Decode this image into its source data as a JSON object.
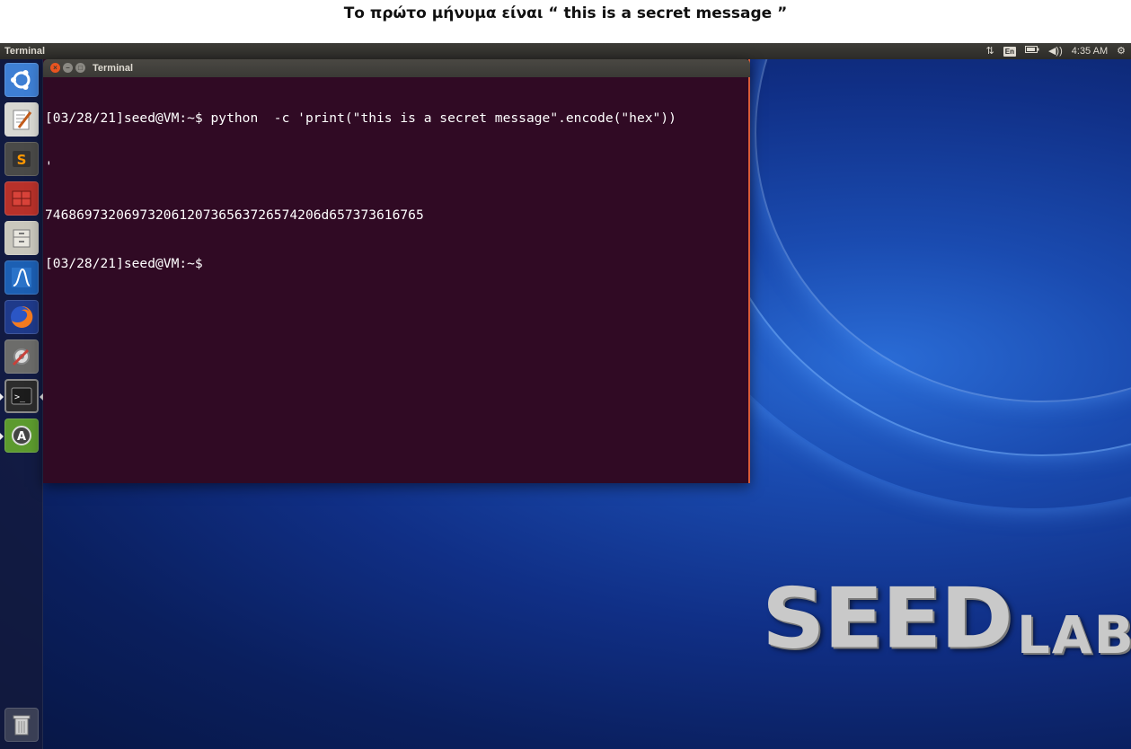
{
  "caption": "Το πρώτο μήνυμα είναι “ this is a secret message ”",
  "top_panel": {
    "app_title": "Terminal",
    "network_icon": "network-arrows-icon",
    "keyboard_layout": "En",
    "battery_icon": "battery-icon",
    "volume_icon": "volume-icon",
    "clock": "4:35 AM",
    "settings_icon": "gear-icon"
  },
  "launcher": {
    "items": [
      {
        "name": "ubuntu-dash",
        "icon": "ubuntu-logo-icon",
        "color": "#3e7fd4"
      },
      {
        "name": "text-editor",
        "icon": "text-editor-icon",
        "color": "#d8d8d2"
      },
      {
        "name": "sublime-text",
        "icon": "sublime-text-icon",
        "color": "#4a4a48"
      },
      {
        "name": "wireshark-red",
        "icon": "red-app-icon",
        "color": "#b8312a"
      },
      {
        "name": "file-manager",
        "icon": "file-cabinet-icon",
        "color": "#c9c7bd"
      },
      {
        "name": "wireshark",
        "icon": "wireshark-icon",
        "color": "#1c5fb3"
      },
      {
        "name": "firefox",
        "icon": "firefox-icon",
        "color": "#e66000"
      },
      {
        "name": "system-settings",
        "icon": "settings-tools-icon",
        "color": "#c8413a"
      },
      {
        "name": "terminal",
        "icon": "terminal-icon",
        "color": "#2c2c2c"
      },
      {
        "name": "software-updater",
        "icon": "software-updater-icon",
        "color": "#6aa832"
      },
      {
        "name": "trash",
        "icon": "trash-icon",
        "color": "#9a9a9a"
      }
    ]
  },
  "terminal": {
    "title": "Terminal",
    "lines": [
      "[03/28/21]seed@VM:~$ python  -c 'print(\"this is a secret message\".encode(\"hex\"))",
      "'",
      "74686973206973206120736563726574206d657373616765",
      "[03/28/21]seed@VM:~$ "
    ]
  },
  "wallpaper": {
    "logo_big": "SEED",
    "logo_small": "LABS"
  }
}
